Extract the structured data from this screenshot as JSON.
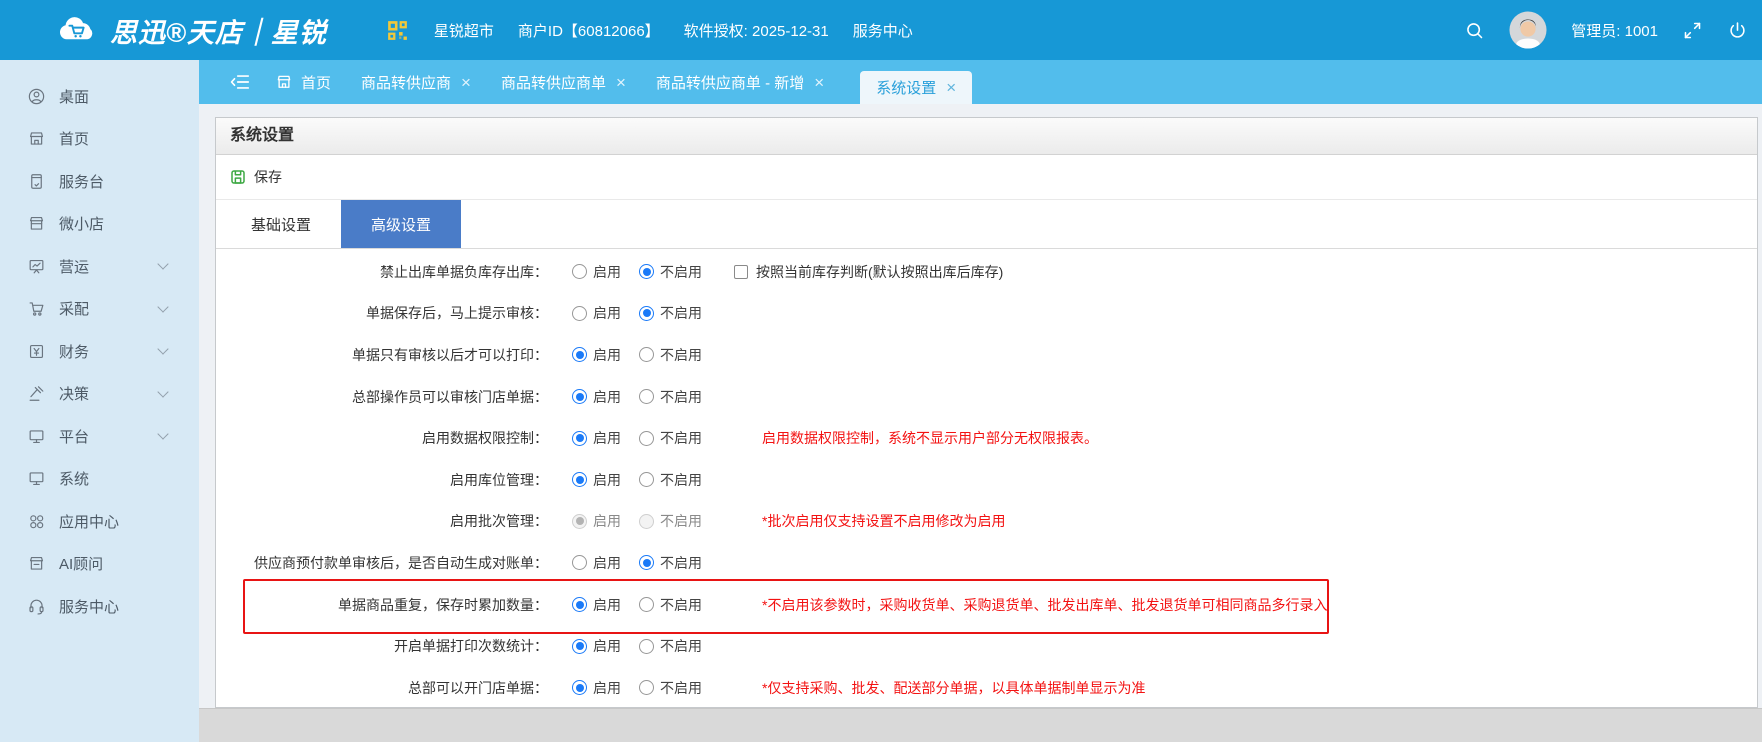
{
  "header": {
    "brand": "思迅®天店｜星锐",
    "store_name": "星锐超市",
    "merchant_id": "商户ID【60812066】",
    "license": "软件授权: 2025-12-31",
    "service_center": "服务中心",
    "admin_label": "管理员: 1001"
  },
  "sidebar": {
    "items": [
      {
        "id": "desktop",
        "label": "桌面",
        "icon": "desktop-icon",
        "expandable": false
      },
      {
        "id": "home",
        "label": "首页",
        "icon": "home-icon",
        "expandable": false
      },
      {
        "id": "service-desk",
        "label": "服务台",
        "icon": "service-desk-icon",
        "expandable": false
      },
      {
        "id": "micro-store",
        "label": "微小店",
        "icon": "micro-store-icon",
        "expandable": false
      },
      {
        "id": "operations",
        "label": "营运",
        "icon": "operations-icon",
        "expandable": true
      },
      {
        "id": "procurement",
        "label": "采配",
        "icon": "procurement-icon",
        "expandable": true
      },
      {
        "id": "finance",
        "label": "财务",
        "icon": "finance-icon",
        "expandable": true
      },
      {
        "id": "decision",
        "label": "决策",
        "icon": "decision-icon",
        "expandable": true
      },
      {
        "id": "platform",
        "label": "平台",
        "icon": "platform-icon",
        "expandable": true
      },
      {
        "id": "system",
        "label": "系统",
        "icon": "system-icon",
        "expandable": false
      },
      {
        "id": "app-center",
        "label": "应用中心",
        "icon": "app-center-icon",
        "expandable": false
      },
      {
        "id": "ai-advisor",
        "label": "AI顾问",
        "icon": "ai-advisor-icon",
        "expandable": false
      },
      {
        "id": "service-center",
        "label": "服务中心",
        "icon": "service-center-icon",
        "expandable": false
      }
    ]
  },
  "tabbar": {
    "home_label": "首页",
    "tabs": [
      {
        "label": "商品转供应商",
        "closable": true,
        "active": false
      },
      {
        "label": "商品转供应商单",
        "closable": true,
        "active": false
      },
      {
        "label": "商品转供应商单 - 新增",
        "closable": true,
        "active": false
      },
      {
        "label": "系统设置",
        "closable": true,
        "active": true
      }
    ]
  },
  "page": {
    "title": "系统设置",
    "save_label": "保存"
  },
  "settings": {
    "tabs": [
      {
        "label": "基础设置",
        "active": false
      },
      {
        "label": "高级设置",
        "active": true
      }
    ],
    "options": [
      "启用",
      "不启用"
    ],
    "rows": [
      {
        "label": "禁止出库单据负库存出库：",
        "selected": 1,
        "disabled": false,
        "highlighted": false,
        "checkbox": "按照当前库存判断(默认按照出库后库存)",
        "checked": false,
        "note": ""
      },
      {
        "label": "单据保存后，马上提示审核：",
        "selected": 1,
        "disabled": false,
        "highlighted": false,
        "note": ""
      },
      {
        "label": "单据只有审核以后才可以打印：",
        "selected": 0,
        "disabled": false,
        "highlighted": false,
        "note": ""
      },
      {
        "label": "总部操作员可以审核门店单据：",
        "selected": 0,
        "disabled": false,
        "highlighted": false,
        "note": ""
      },
      {
        "label": "启用数据权限控制：",
        "selected": 0,
        "disabled": false,
        "highlighted": false,
        "note": "启用数据权限控制，系统不显示用户部分无权限报表。"
      },
      {
        "label": "启用库位管理：",
        "selected": 0,
        "disabled": false,
        "highlighted": false,
        "note": ""
      },
      {
        "label": "启用批次管理：",
        "selected": 0,
        "disabled": true,
        "highlighted": false,
        "note": "*批次启用仅支持设置不启用修改为启用"
      },
      {
        "label": "供应商预付款单审核后，是否自动生成对账单：",
        "selected": 1,
        "disabled": false,
        "highlighted": false,
        "note": ""
      },
      {
        "label": "单据商品重复，保存时累加数量：",
        "selected": 0,
        "disabled": false,
        "highlighted": true,
        "note": "*不启用该参数时，采购收货单、采购退货单、批发出库单、批发退货单可相同商品多行录入"
      },
      {
        "label": "开启单据打印次数统计：",
        "selected": 0,
        "disabled": false,
        "highlighted": false,
        "note": ""
      },
      {
        "label": "总部可以开门店单据：",
        "selected": 0,
        "disabled": false,
        "highlighted": false,
        "note": "*仅支持采购、批发、配送部分单据，以具体单据制单显示为准"
      }
    ]
  },
  "colors": {
    "header_blue": "#1798d6",
    "tabstrip_blue": "#52bdec",
    "active_tab_blue": "#4a7cc8",
    "radio_blue": "#1a7af8",
    "note_red": "#f31212",
    "save_green": "#3da843",
    "qr_yellow": "#f2c83a"
  }
}
